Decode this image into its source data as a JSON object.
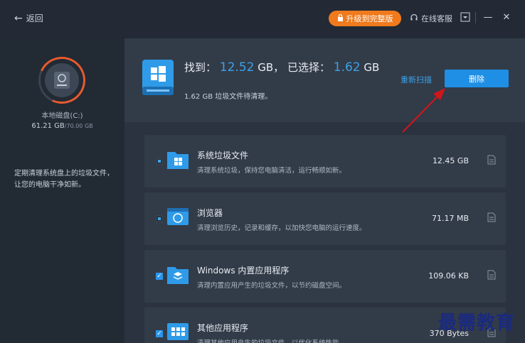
{
  "titlebar": {
    "back_label": "返回",
    "upgrade_label": "升级到完整版",
    "support_label": "在线客服"
  },
  "sidebar": {
    "disk_name": "本地磁盘(C:)",
    "disk_used": "61.21 GB",
    "disk_total": "/70.00 GB",
    "tip": "定期清理系统盘上的垃圾文件，让您的电脑干净如新。"
  },
  "header": {
    "found_label": "找到：",
    "found_value": "12.52",
    "found_unit": "GB，",
    "selected_label": "已选择：",
    "selected_value": "1.62",
    "selected_unit": "GB",
    "clean_size": "1.62",
    "clean_note": "GB 垃圾文件待清理。",
    "rescan_label": "重新扫描",
    "delete_label": "删除"
  },
  "items": [
    {
      "title": "系统垃圾文件",
      "desc": "清理系统垃圾，保持您电脑清洁，运行畅顺如新。",
      "size": "12.45 GB",
      "check": "partial"
    },
    {
      "title": "浏览器",
      "desc": "清理浏览历史，记录和缓存，以加快您电脑的运行速度。",
      "size": "71.17 MB",
      "check": "partial"
    },
    {
      "title": "Windows 内置应用程序",
      "desc": "清理内置应用产生的垃圾文件，以节约磁盘空间。",
      "size": "109.06 KB",
      "check": "full"
    },
    {
      "title": "其他应用程序",
      "desc": "清理其他应用产生的垃圾文件，以优化系统性能。",
      "size": "370 Bytes",
      "check": "full"
    }
  ],
  "watermark": "最需教育",
  "colors": {
    "accent": "#1f8fe5",
    "highlight": "#3aa2e8",
    "upgrade": "#f07a1c",
    "ring": "#e85a2e",
    "arrow": "#d0161b"
  }
}
